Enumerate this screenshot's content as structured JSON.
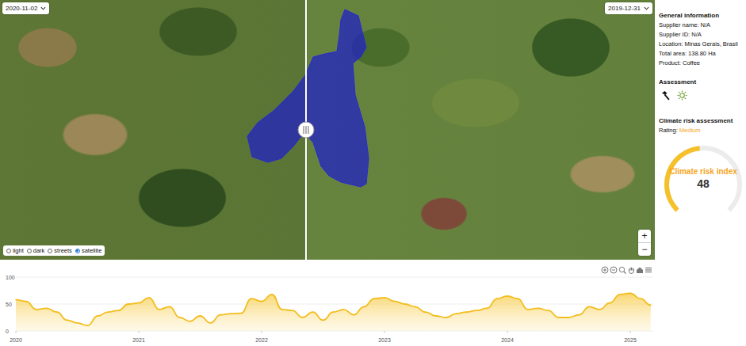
{
  "map": {
    "left_date": "2020-11-02",
    "right_date": "2019-12-31",
    "base_layers": [
      {
        "label": "light",
        "selected": false
      },
      {
        "label": "dark",
        "selected": false
      },
      {
        "label": "streets",
        "selected": false
      },
      {
        "label": "satellite",
        "selected": true
      }
    ],
    "zoom_in": "+",
    "zoom_out": "−"
  },
  "info": {
    "title": "General information",
    "fields": [
      "Supplier name: N/A",
      "Supplier ID: N/A",
      "Location: Minas Gerais, Brasil",
      "Total area: 138.80 Ha",
      "Product: Coffee"
    ]
  },
  "assessment": {
    "title": "Assessment"
  },
  "climate": {
    "title": "Climate risk assessment",
    "rating_label": "Rating:",
    "rating": "Medium",
    "gauge": {
      "label": "Climate risk index",
      "value": "48",
      "level": 0.48
    }
  },
  "chart": {
    "y_ticks": [
      "100",
      "50",
      "0"
    ],
    "x_ticks": [
      "2020",
      "2021",
      "2022",
      "2023",
      "2024",
      "2025"
    ],
    "series": [
      {
        "values": [
          58,
          55,
          40,
          42,
          35,
          20,
          15,
          10,
          28,
          35,
          38,
          50,
          52,
          62,
          40,
          45,
          25,
          18,
          28,
          15,
          30,
          32,
          33,
          60,
          55,
          68,
          40,
          38,
          25,
          35,
          20,
          35,
          40,
          30,
          45,
          60,
          62,
          55,
          50,
          45,
          35,
          28,
          25,
          32,
          35,
          38,
          42,
          60,
          65,
          60,
          40,
          42,
          38,
          25,
          25,
          30,
          45,
          40,
          52,
          68,
          70,
          60,
          48
        ]
      }
    ]
  }
}
